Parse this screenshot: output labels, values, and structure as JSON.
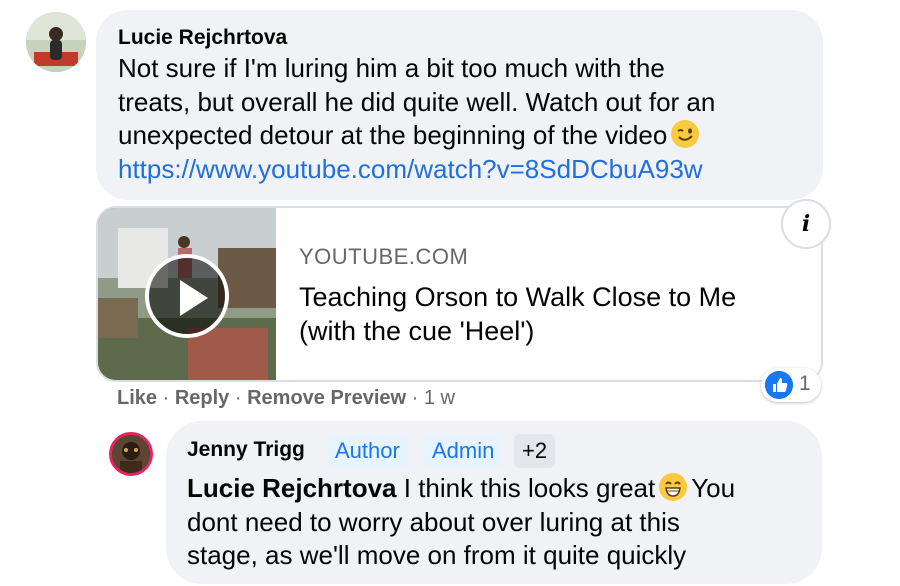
{
  "comment": {
    "author": "Lucie Rejchrtova",
    "text_lines": [
      "Not sure if I'm luring him a bit too much with the",
      "treats, but overall he did quite well. Watch out for an",
      "unexpected detour at the beginning of the video"
    ],
    "link": "https://www.youtube.com/watch?v=8SdDCbuA93w",
    "preview": {
      "domain": "YOUTUBE.COM",
      "title": "Teaching Orson to Walk Close to Me (with the cue 'Heel')"
    },
    "reactions": {
      "icon": "like-icon",
      "count": "1"
    },
    "actions": {
      "like": "Like",
      "reply": "Reply",
      "remove_preview": "Remove Preview",
      "separator": "·",
      "time": "1 w"
    }
  },
  "reply": {
    "author": "Jenny Trigg",
    "badges": [
      "Author",
      "Admin",
      "+2"
    ],
    "mention": "Lucie Rejchrtova",
    "text_first": "I think this looks great",
    "text_after_emoji": "You",
    "text_lines": [
      "dont need to worry about over luring at this",
      "stage, as we'll move on from it quite quickly"
    ]
  },
  "colors": {
    "bubble": "#f0f2f5",
    "link": "#216fdb",
    "muted": "#65676b",
    "like_blue": "#1877f2",
    "badge_blue_bg": "#e7f3ff",
    "avatar_ring": "#e4245f"
  }
}
